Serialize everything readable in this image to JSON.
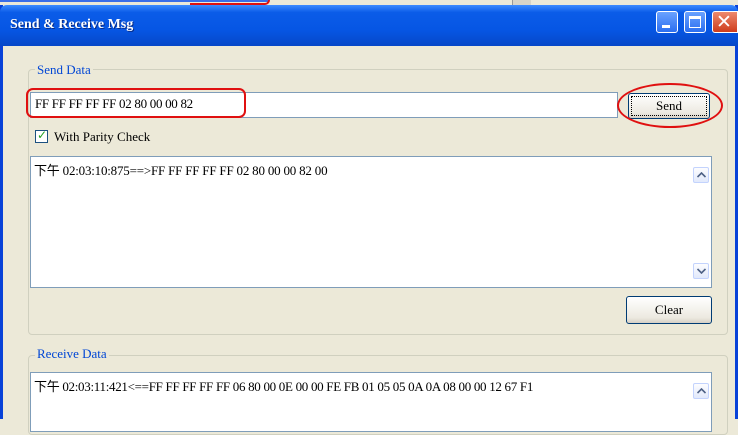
{
  "window": {
    "title": "Send & Receive Msg"
  },
  "send": {
    "legend": "Send Data",
    "input_value": "FF FF FF FF FF 02 80 00 00 82",
    "send_label": "Send",
    "parity_label": "With Parity Check",
    "parity_checked": true,
    "log": "下午 02:03:10:875==>FF FF FF FF FF 02 80 00 00 82 00",
    "clear_label": "Clear"
  },
  "receive": {
    "legend": "Receive Data",
    "log": "下午 02:03:11:421<==FF FF FF FF FF 06 80 00 0E 00 00 FE FB 01 05 05 0A 0A 08 00 00 12 67 F1"
  },
  "colors": {
    "title_bar": "#0656e4",
    "annotation_red": "#e01010",
    "legend_text": "#0046d5",
    "check_green": "#21a121"
  }
}
